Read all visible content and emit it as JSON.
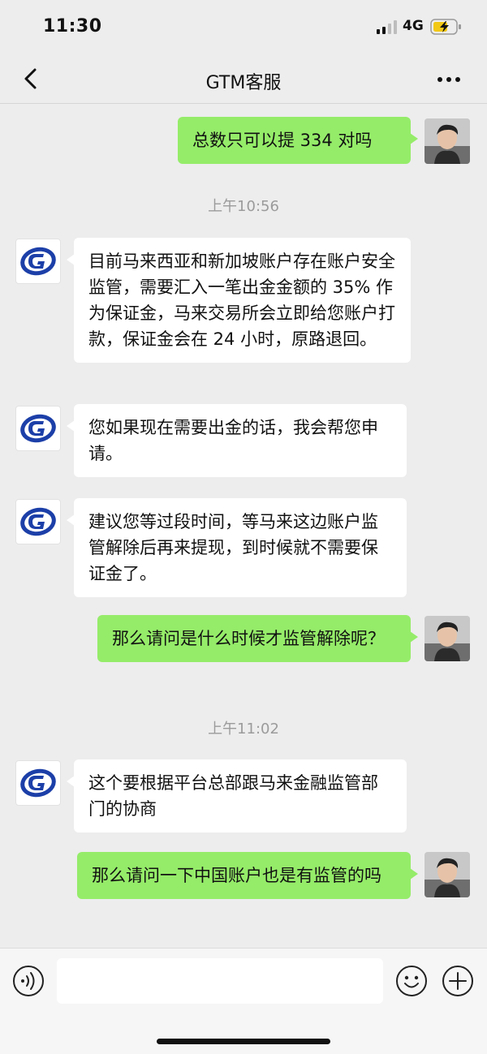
{
  "status_bar": {
    "time": "11:30",
    "network": "4G"
  },
  "nav": {
    "title": "GTM客服"
  },
  "messages": [
    {
      "text": "总数只可以提 334 对吗"
    },
    {
      "text": "上午10:56"
    },
    {
      "text": "目前马来西亚和新加坡账户存在账户安全监管，需要汇入一笔出金金额的 35% 作为保证金，马来交易所会立即给您账户打款，保证金会在 24 小时，原路退回。"
    },
    {
      "text": "您如果现在需要出金的话，我会帮您申请。"
    },
    {
      "text": "建议您等过段时间，等马来这边账户监管解除后再来提现，到时候就不需要保证金了。"
    },
    {
      "text": "那么请问是什么时候才监管解除呢？"
    },
    {
      "text": "上午11:02"
    },
    {
      "text": "这个要根据平台总部跟马来金融监管部门的协商"
    },
    {
      "text": "那么请问一下中国账户也是有监管的吗"
    }
  ],
  "input": {
    "value": ""
  },
  "colors": {
    "background": "#ededed",
    "outgoing_bubble": "#95ec69",
    "incoming_bubble": "#ffffff",
    "timestamp": "#9b9b9b"
  },
  "icons": [
    "back-arrow-icon",
    "more-dots-icon",
    "signal-icon",
    "battery-charging-icon",
    "voice-icon",
    "emoji-icon",
    "plus-icon"
  ]
}
